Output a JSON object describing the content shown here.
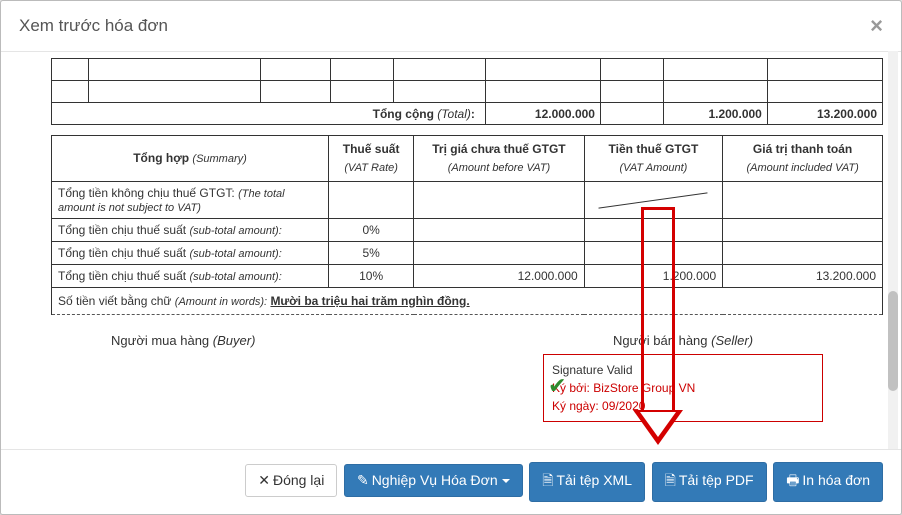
{
  "modal": {
    "title": "Xem trước hóa đơn"
  },
  "items_total": {
    "label": "Tổng cộng",
    "label_en": "(Total)",
    "amount": "12.000.000",
    "vat": "1.200.000",
    "grand": "13.200.000"
  },
  "summary": {
    "headers": {
      "c1": "Tổng hợp",
      "c1_en": "(Summary)",
      "c2": "Thuế suất",
      "c2_en": "(VAT Rate)",
      "c3": "Trị giá chưa thuế GTGT",
      "c3_en": "(Amount before VAT)",
      "c4": "Tiền thuế GTGT",
      "c4_en": "(VAT Amount)",
      "c5": "Giá trị thanh toán",
      "c5_en": "(Amount included VAT)"
    },
    "rows": [
      {
        "label": "Tổng tiền không chịu thuế GTGT:",
        "label_en": "(The total amount is not subject to VAT)",
        "rate": "",
        "before": "",
        "vat": "slash",
        "total": ""
      },
      {
        "label": "Tổng tiền chịu thuế suất",
        "label_en": "(sub-total amount):",
        "rate": "0%",
        "before": "",
        "vat": "",
        "total": ""
      },
      {
        "label": "Tổng tiền chịu thuế suất",
        "label_en": "(sub-total amount):",
        "rate": "5%",
        "before": "",
        "vat": "",
        "total": ""
      },
      {
        "label": "Tổng tiền chịu thuế suất",
        "label_en": "(sub-total amount):",
        "rate": "10%",
        "before": "12.000.000",
        "vat": "1.200.000",
        "total": "13.200.000"
      }
    ],
    "words_label": "Số tiền viết bằng chữ",
    "words_label_en": "(Amount in words):",
    "words_value": "Mười ba triệu hai trăm nghìn đồng."
  },
  "sig": {
    "buyer": "Người mua hàng",
    "buyer_en": "(Buyer)",
    "seller": "Người bán hàng",
    "seller_en": "(Seller)",
    "valid": "Signature Valid",
    "signed_by_label": "Ký bởi:",
    "signed_by": "BizStore Group VN",
    "signed_date_label": "Ký ngày:",
    "signed_date": "09/2020"
  },
  "buttons": {
    "close": "Đóng lại",
    "ops": "Nghiệp Vụ Hóa Đơn",
    "xml": "Tải tệp XML",
    "pdf": "Tải tệp PDF",
    "print": "In hóa đơn"
  }
}
